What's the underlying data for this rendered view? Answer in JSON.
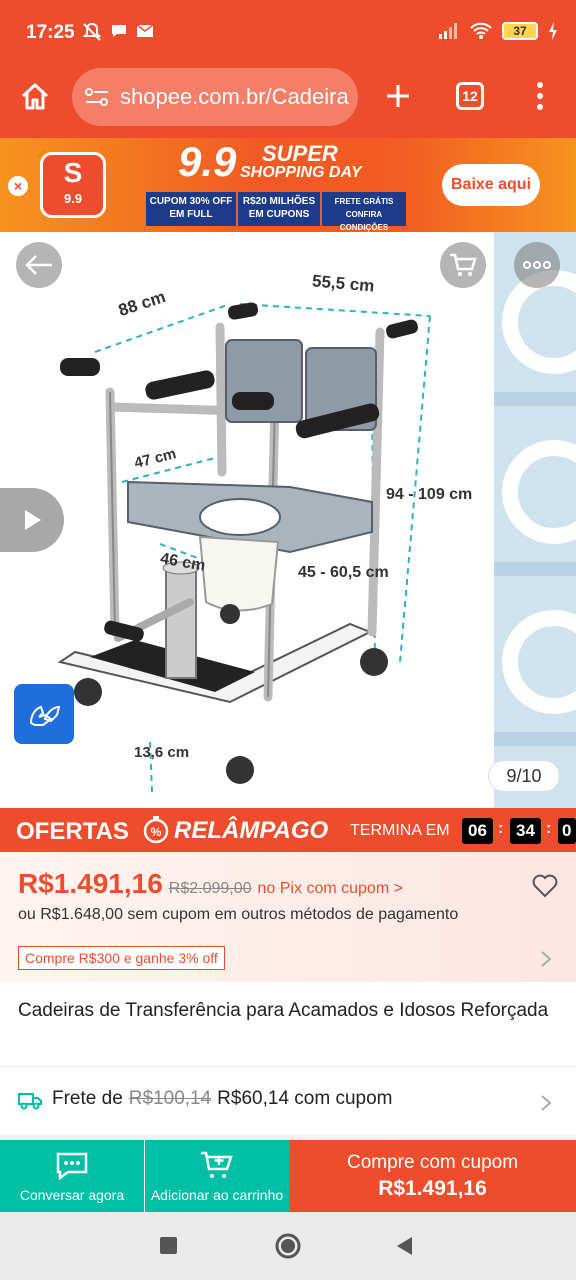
{
  "status_bar": {
    "time": "17:25",
    "battery": "37"
  },
  "browser": {
    "url": "shopee.com.br/Cadeira",
    "tab_count": "12"
  },
  "banner": {
    "logo_text": "9.9",
    "big_number": "9.9",
    "headline_1": "SUPER",
    "headline_2": "SHOPPING DAY",
    "chip_1": "CUPOM 30% OFF EM FULL",
    "chip_2": "R$20 MILHÕES EM CUPONS",
    "chip_3": "FRETE GRÁTIS CONFIRA CONDIÇÕES",
    "cta": "Baixe aqui"
  },
  "product_image": {
    "dim_depth": "88 cm",
    "dim_width": "55,5 cm",
    "dim_seat_depth": "47 cm",
    "dim_height": "94 - 109 cm",
    "dim_seat_width": "46 cm",
    "dim_seat_height": "45 - 60,5 cm",
    "dim_base": "13,6 cm",
    "counter": "9/10"
  },
  "flash_sale": {
    "title_1": "OFERTAS",
    "title_2": "RELÂMPAGO",
    "ends_label": "TERMINA EM",
    "hh": "06",
    "mm": "34",
    "ss": "0"
  },
  "price": {
    "current": "R$1.491,16",
    "original": "R$2.099,00",
    "pix_note": "no Pix com cupom >",
    "alt_note": "ou R$1.648,00 sem cupom em outros métodos de pagamento",
    "promo": "Compre R$300 e ganhe 3% off"
  },
  "product": {
    "title": "Cadeiras de Transferência para Acamados e Idosos Reforçada"
  },
  "shipping": {
    "label": "Frete de",
    "old_price": "R$100,14",
    "new_price": "R$60,14 com cupom"
  },
  "actions": {
    "chat": "Conversar agora",
    "cart": "Adicionar ao carrinho",
    "buy_label": "Compre com cupom",
    "buy_price": "R$1.491,16"
  },
  "colors": {
    "brand": "#ee4d2d",
    "chip": "#1e3a8a",
    "teal": "#00bfa5"
  }
}
